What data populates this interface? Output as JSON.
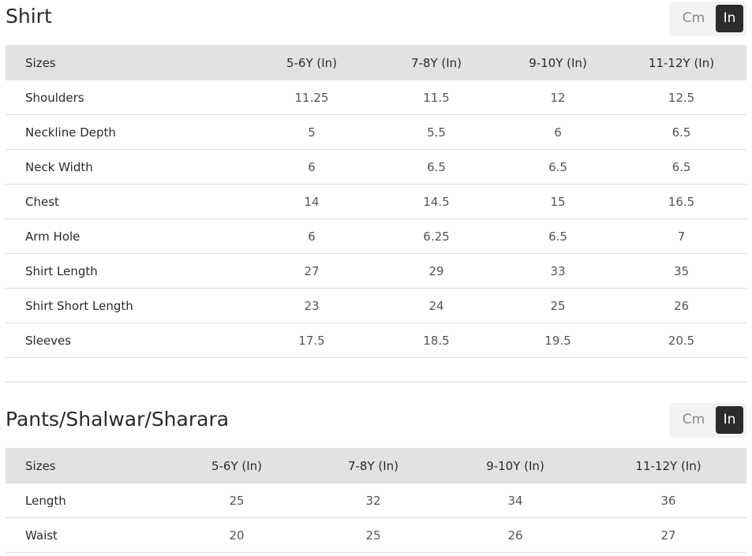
{
  "shirt": {
    "title": "Shirt",
    "unit_cm": "Cm",
    "unit_in": "In",
    "headers": [
      "Sizes",
      "5-6Y (In)",
      "7-8Y (In)",
      "9-10Y (In)",
      "11-12Y (In)"
    ],
    "rows": [
      [
        "Shoulders",
        "11.25",
        "11.5",
        "12",
        "12.5"
      ],
      [
        "Neckline Depth",
        "5",
        "5.5",
        "6",
        "6.5"
      ],
      [
        "Neck Width",
        "6",
        "6.5",
        "6.5",
        "6.5"
      ],
      [
        "Chest",
        "14",
        "14.5",
        "15",
        "16.5"
      ],
      [
        "Arm Hole",
        "6",
        "6.25",
        "6.5",
        "7"
      ],
      [
        "Shirt Length",
        "27",
        "29",
        "33",
        "35"
      ],
      [
        "Shirt Short Length",
        "23",
        "24",
        "25",
        "26"
      ],
      [
        "Sleeves",
        "17.5",
        "18.5",
        "19.5",
        "20.5"
      ]
    ]
  },
  "pants": {
    "title": "Pants/Shalwar/Sharara",
    "unit_cm": "Cm",
    "unit_in": "In",
    "headers": [
      "Sizes",
      "5-6Y (In)",
      "7-8Y (In)",
      "9-10Y (In)",
      "11-12Y (In)"
    ],
    "rows": [
      [
        "Length",
        "25",
        "32",
        "34",
        "36"
      ],
      [
        "Waist",
        "20",
        "25",
        "26",
        "27"
      ]
    ]
  }
}
